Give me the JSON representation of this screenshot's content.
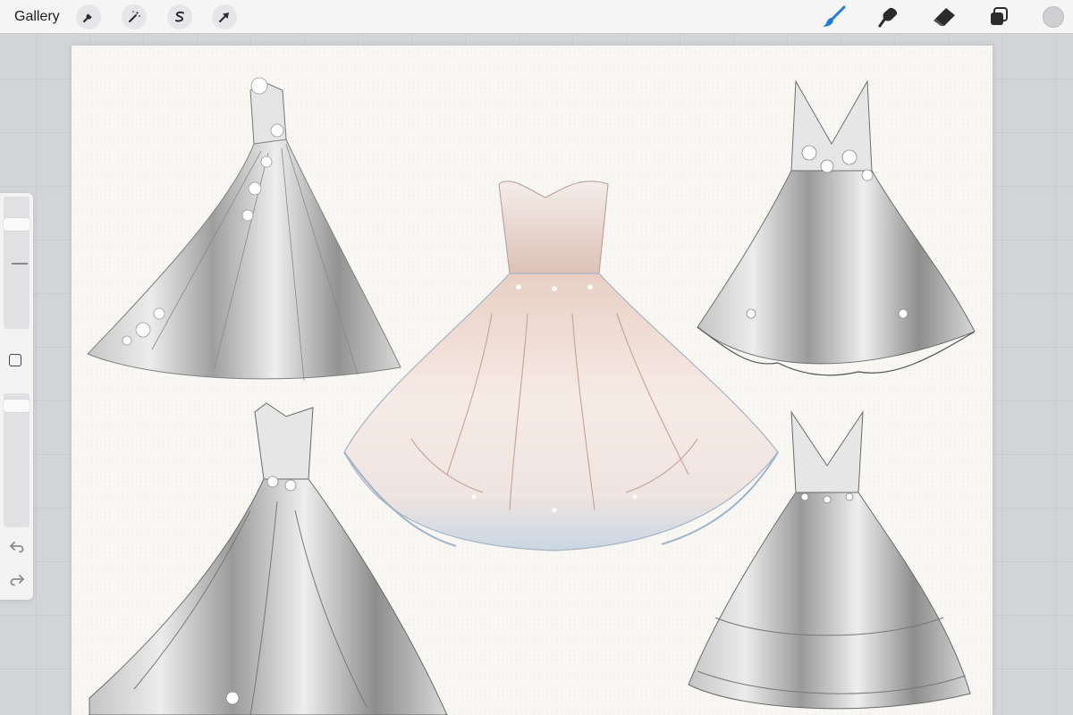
{
  "topbar": {
    "gallery_label": "Gallery",
    "left_tools": [
      "wrench-icon",
      "magic-wand-icon",
      "selection-s-icon",
      "arrow-cursor-icon"
    ],
    "right_tools": [
      "brush-icon",
      "smudge-icon",
      "eraser-icon",
      "layers-icon",
      "color-well"
    ],
    "active_tool": "brush",
    "accent_color": "#1e7ae6"
  },
  "sidebar": {
    "brush_size_level": 0.18,
    "opacity_level": 0.05,
    "modifier": "square-icon",
    "undo": "undo-icon",
    "redo": "redo-icon"
  },
  "canvas": {
    "background_color": "#f8f7f4",
    "artworks": [
      "wedding-gown-floral-sketch",
      "strapless-ball-gown-blush",
      "v-neck-floral-dress-sketch",
      "ruffled-gown-sketch",
      "tiered-v-neck-gown-sketch"
    ]
  }
}
